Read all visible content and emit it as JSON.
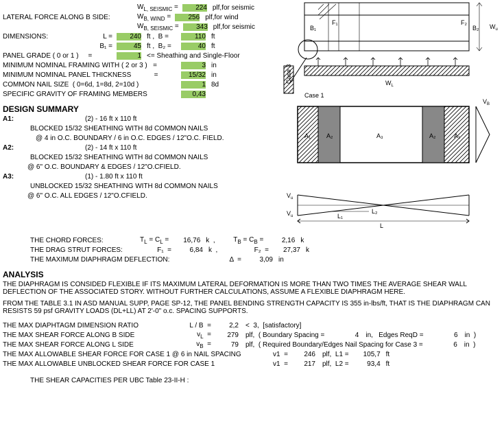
{
  "inputs": {
    "wl_seismic_label": "W",
    "wl_seismic_sub": "L, SEISMIC",
    "wl_seismic_eq": " =",
    "wl_seismic_val": "224",
    "wl_seismic_unit": "plf,for seismic",
    "force_b_label": "LATERAL FORCE ALONG B SIDE:",
    "wb_wind_label": "W",
    "wb_wind_sub": "B, WIND",
    "wb_wind_eq": " =",
    "wb_wind_val": "256",
    "wb_wind_unit": "plf,for wind",
    "wb_seismic_label": "W",
    "wb_seismic_sub": "B, SEISMIC",
    "wb_seismic_eq": " =",
    "wb_seismic_val": "343",
    "wb_seismic_unit": "plf,for seismic",
    "dim_label": "DIMENSIONS:",
    "L_lbl": "L =",
    "L_val": "240",
    "L_unit": "ft ,  B =",
    "B_val": "110",
    "B_unit": "ft",
    "B1_lbl": "B₁ =",
    "B1_val": "45",
    "B1_unit": "ft ,  B₂ =",
    "B2_val": "40",
    "B2_unit": "ft",
    "panel_grade_lbl": "PANEL GRADE ( 0 or 1 )     =",
    "panel_grade_val": "1",
    "panel_grade_note": "<= Sheathing and Single-Floor",
    "framing_lbl": "MINIMUM NOMINAL FRAMING WITH ( 2 or 3 )   =",
    "framing_val": "3",
    "framing_unit": "in",
    "thickness_lbl": "MINIMUM NOMINAL PANEL THICKNESS            =",
    "thickness_val": "15/32",
    "thickness_unit": "in",
    "nail_lbl": "COMMON NAIL SIZE  ( 0=6d, 1=8d, 2=10d )",
    "nail_val": "1",
    "nail_unit": "8d",
    "sg_lbl": "SPECIFIC GRAVITY OF FRAMING MEMBERS",
    "sg_val": "0,43"
  },
  "design": {
    "title": "DESIGN SUMMARY",
    "a1_lbl": "A1:",
    "a1_dim": "(2) - 16 ft x 110 ft",
    "a1_l1": "BLOCKED 15/32 SHEATHING WITH 8d COMMON NAILS",
    "a1_l2": "@ 4 in O.C. BOUNDARY / 6 in O.C. EDGES / 12\"O.C. FIELD.",
    "a2_lbl": "A2:",
    "a2_dim": "(2) - 14 ft x 110 ft",
    "a2_l1": "BLOCKED 15/32 SHEATHING WITH 8d COMMON NAILS",
    "a2_l2": "@ 6\" O.C. BOUNDARY & EDGES / 12\"O.CFIELD.",
    "a3_lbl": "A3:",
    "a3_dim": "(1) - 1.80 ft x 110 ft",
    "a3_l1": "UNBLOCKED 15/32 SHEATHING WITH 8d COMMON NAILS",
    "a3_l2": "@ 6\" O.C. ALL EDGES / 12\"O.CFIELD.",
    "chord_lbl": "THE CHORD FORCES:",
    "tl_lbl": "T",
    "tl_sub": "L",
    "cl_lbl": " = C",
    "cl_sub": "L",
    "cl_eq": " =",
    "tl_val": "16,76",
    "tl_unit": "k  ,",
    "tb_lbl": "T",
    "tb_sub": "B",
    "cb_lbl": " = C",
    "cb_sub": "B",
    "cb_eq": " =",
    "tb_val": "2,16",
    "tb_unit": "k",
    "drag_lbl": "THE DRAG STRUT FORCES:",
    "f1_lbl": "F₁  =",
    "f1_val": "6,84",
    "f1_unit": "k  ,",
    "f2_lbl": "F₂  =",
    "f2_val": "27,37",
    "f2_unit": "k",
    "defl_lbl": "THE MAXIMUM DIAPHRAGM DEFLECTION:",
    "delta_lbl": "Δ  =",
    "delta_val": "3,09",
    "delta_unit": "in"
  },
  "analysis": {
    "title": "ANALYSIS",
    "p1": "THE DIAPHRAGM IS CONSIDED FLEXIBLE IF ITS MAXIMUM LATERAL DEFORMATION IS MORE THAN TWO TIMES THE AVERAGE SHEAR WALL DEFLECTION OF THE ASSOCIATED STORY. WITHOUT FURTHER CALCULATIONS, ASSUME A FLEXIBLE DIAPHRAGM HERE.",
    "p2": "FROM THE TABLE 3.1 IN ASD MANUAL SUPP, PAGE SP-12, THE PANEL BENDING STRENGTH CAPACITY IS 355 in-lbs/ft, THAT IS THE DIAPHRAGM CAN RESISTS 59 psf GRAVITY LOADS (DL+LL) AT 2'-0\" o.c. SPACING SUPPORTS.",
    "ratio_lbl": "THE MAX DIAPHTAGM DIMENSION RATIO",
    "ratio_sym": "L / B  =",
    "ratio_val": "2,2",
    "ratio_note": "<  3,  [satisfactory]",
    "vb_lbl": "THE MAX SHEAR FORCE ALONG B SIDE",
    "vL_sym": "v",
    "vL_sub": "L",
    "vL_eq": "  =",
    "vL_val": "279",
    "vL_unit": "plf,  ( Boundary Spacing =",
    "vL_bs": "4",
    "vL_bs_unit": "in,   Edges ReqD =",
    "vL_er": "6",
    "vL_er_unit": "in  )",
    "vl_lbl": "THE MAX SHEAR FORCE ALONG L SIDE",
    "vB_sym": "v",
    "vB_sub": "B",
    "vB_eq": "  =",
    "vB_val": "79",
    "vB_unit": "plf,  ( Required Boundary/Edges Nail Spacing for Case 3 =",
    "vB_sp": "6",
    "vB_sp_unit": "in  )",
    "allow1_lbl": "THE MAX ALLOWABLE SHEAR FORCE FOR CASE 1 @ 6 in NAIL SPACING",
    "v1a_lbl": "v1  =",
    "v1a_val": "246",
    "v1a_unit": "plf,  L1 =",
    "L1_val": "105,7",
    "L1_unit": "ft",
    "allow2_lbl": "THE MAX ALLOWABLE UNBLOCKED SHEAR FORCE FOR CASE 1",
    "v1b_lbl": "v1  =",
    "v1b_val": "217",
    "v1b_unit": "plf,  L2 =",
    "L2_val": "93,4",
    "L2_unit": "ft",
    "cap_lbl": "THE SHEAR CAPACITIES PER UBC Table 23-II-H :"
  },
  "diagrams": {
    "case3": "Case 3",
    "case1": "Case 1",
    "WL": "W",
    "WL_sub": "L",
    "B1": "B₁",
    "B2": "B₂",
    "F1": "F₁",
    "F2": "F₂",
    "TB": "T",
    "TB_sub": "B",
    "CB": "=C",
    "CB_sub": "B",
    "TL": "T",
    "TL_sub": "L",
    "CL": "=C",
    "CL_sub": "L",
    "Wu": "W",
    "Wu_sub": "u",
    "Vb": "V",
    "Vb_sub": "B",
    "Vu": "V",
    "Vu_sub": "u",
    "A1t": "A₁",
    "A2t": "A₂",
    "A3t": "A₃",
    "L": "L",
    "L1": "L₁",
    "L2": "L₂"
  }
}
